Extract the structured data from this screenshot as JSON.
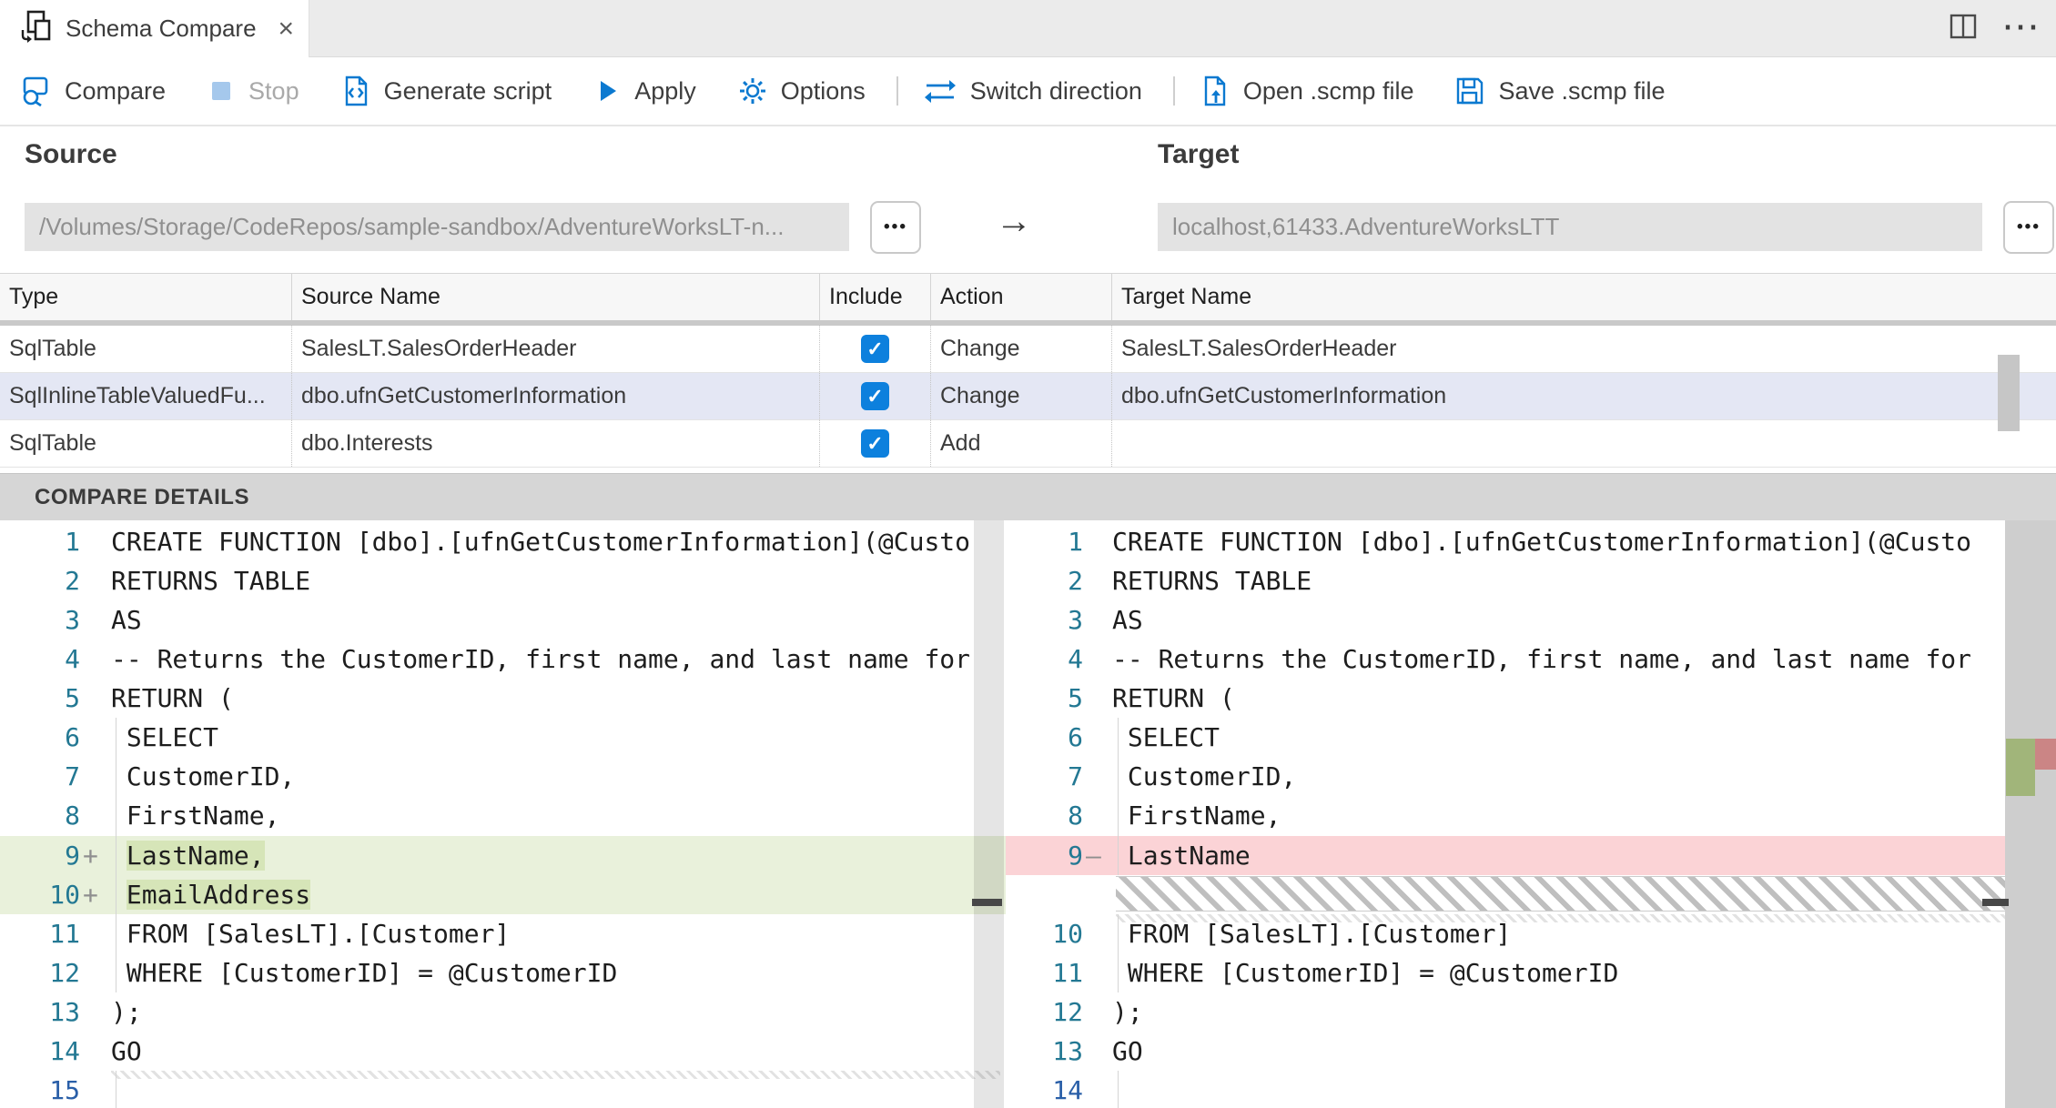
{
  "tab": {
    "title": "Schema Compare",
    "close_glyph": "×"
  },
  "window": {
    "more_glyph": "⋯"
  },
  "icons": {
    "check": "✓",
    "browse": "•••",
    "arrow_right": "→"
  },
  "toolbar": {
    "buttons": [
      {
        "id": "compare",
        "label": "Compare",
        "disabled": false
      },
      {
        "id": "stop",
        "label": "Stop",
        "disabled": true
      },
      {
        "id": "generate-script",
        "label": "Generate script",
        "disabled": false
      },
      {
        "id": "apply",
        "label": "Apply",
        "disabled": false
      },
      {
        "id": "options",
        "label": "Options",
        "disabled": false
      },
      {
        "id": "switch-direction",
        "label": "Switch direction",
        "disabled": false
      },
      {
        "id": "open-scmp",
        "label": "Open .scmp file",
        "disabled": false
      },
      {
        "id": "save-scmp",
        "label": "Save .scmp file",
        "disabled": false
      }
    ]
  },
  "source": {
    "heading": "Source",
    "path": "/Volumes/Storage/CodeRepos/sample-sandbox/AdventureWorksLT-n..."
  },
  "target": {
    "heading": "Target",
    "connection": "localhost,61433.AdventureWorksLTT"
  },
  "table": {
    "columns": [
      {
        "label": "Type"
      },
      {
        "label": "Source Name"
      },
      {
        "label": "Include"
      },
      {
        "label": "Action"
      },
      {
        "label": "Target Name"
      }
    ],
    "rows": [
      {
        "type": "SqlTable",
        "source": "SalesLT.SalesOrderHeader",
        "include": true,
        "action": "Change",
        "target": "SalesLT.SalesOrderHeader",
        "selected": false
      },
      {
        "type": "SqlInlineTableValuedFu...",
        "source": "dbo.ufnGetCustomerInformation",
        "include": true,
        "action": "Change",
        "target": "dbo.ufnGetCustomerInformation",
        "selected": true
      },
      {
        "type": "SqlTable",
        "source": "dbo.Interests",
        "include": true,
        "action": "Add",
        "target": "",
        "selected": false
      }
    ]
  },
  "compare_details": {
    "title": "COMPARE DETAILS"
  },
  "editors": {
    "left": {
      "lines": [
        {
          "n": 1,
          "text": "CREATE FUNCTION [dbo].[ufnGetCustomerInformation](@Custo"
        },
        {
          "n": 2,
          "text": "RETURNS TABLE"
        },
        {
          "n": 3,
          "text": "AS"
        },
        {
          "n": 4,
          "text": "-- Returns the CustomerID, first name, and last name for"
        },
        {
          "n": 5,
          "text": "RETURN ("
        },
        {
          "n": 6,
          "text": " SELECT",
          "guide": true
        },
        {
          "n": 7,
          "text": " CustomerID,",
          "guide": true
        },
        {
          "n": 8,
          "text": " FirstName,",
          "guide": true
        },
        {
          "n": 9,
          "text": " LastName,",
          "kind": "add",
          "marker": "+",
          "hl": "LastName,",
          "guide": true
        },
        {
          "n": 10,
          "text": " EmailAddress",
          "kind": "add",
          "marker": "+",
          "hl": "EmailAddress",
          "guide": true
        },
        {
          "n": 11,
          "text": " FROM [SalesLT].[Customer]",
          "guide": true
        },
        {
          "n": 12,
          "text": " WHERE [CustomerID] = @CustomerID",
          "guide": true
        },
        {
          "n": 13,
          "text": ");"
        },
        {
          "n": 14,
          "text": "GO"
        },
        {
          "n": 15,
          "text": "",
          "guide": true,
          "faint": true,
          "active": true
        }
      ]
    },
    "right": {
      "lines": [
        {
          "n": 1,
          "text": "CREATE FUNCTION [dbo].[ufnGetCustomerInformation](@Custo"
        },
        {
          "n": 2,
          "text": "RETURNS TABLE"
        },
        {
          "n": 3,
          "text": "AS"
        },
        {
          "n": 4,
          "text": "-- Returns the CustomerID, first name, and last name for"
        },
        {
          "n": 5,
          "text": "RETURN ("
        },
        {
          "n": 6,
          "text": " SELECT",
          "guide": true
        },
        {
          "n": 7,
          "text": " CustomerID,",
          "guide": true
        },
        {
          "n": 8,
          "text": " FirstName,",
          "guide": true
        },
        {
          "n": 9,
          "text": " LastName",
          "kind": "del",
          "marker": "–",
          "guide": true
        },
        {
          "kind": "filler"
        },
        {
          "n": 10,
          "text": " FROM [SalesLT].[Customer]",
          "guide": true,
          "faint": true
        },
        {
          "n": 11,
          "text": " WHERE [CustomerID] = @CustomerID",
          "guide": true
        },
        {
          "n": 12,
          "text": ");"
        },
        {
          "n": 13,
          "text": "GO"
        },
        {
          "n": 14,
          "text": "",
          "guide": true,
          "active": true
        }
      ]
    }
  },
  "colors": {
    "accent": "#0b79d0",
    "checkbox": "#0d80dd",
    "added_line": "#e9f1db",
    "added_char": "#d6e5b8",
    "deleted_line": "#fbd3d6",
    "selected_row": "#e4e7f4",
    "line_number": "#237893",
    "details_bar": "#d6d6d6",
    "input_bg": "#e3e3e3"
  }
}
